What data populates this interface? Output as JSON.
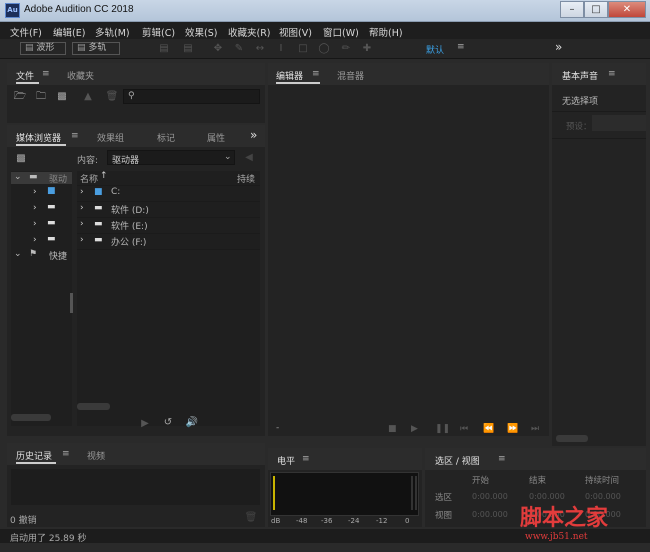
{
  "window": {
    "title": "Adobe Audition CC 2018",
    "app_icon": "Au",
    "minimize": "–",
    "maximize": "□",
    "close": "✕"
  },
  "menu": [
    "文件(F)",
    "编辑(E)",
    "多轨(M)",
    "剪辑(C)",
    "效果(S)",
    "收藏夹(R)",
    "视图(V)",
    "窗口(W)",
    "帮助(H)"
  ],
  "toolbar": {
    "waveform_label": "波形",
    "multitrack_label": "多轨",
    "workspace": "默认",
    "more": "»"
  },
  "files_panel": {
    "tabs": [
      "文件",
      "收藏夹"
    ],
    "search_placeholder": ""
  },
  "media_browser": {
    "tabs": [
      "媒体浏览器",
      "效果组",
      "标记",
      "属性"
    ],
    "more": "»",
    "content_label": "内容:",
    "content_value": "驱动器",
    "tree": [
      "驱动",
      "快捷"
    ],
    "columns": {
      "name": "名称",
      "duration": "持续"
    },
    "rows": [
      "C:",
      "软件 (D:)",
      "软件 (E:)",
      "办公 (F:)"
    ]
  },
  "editor": {
    "tabs": [
      "编辑器",
      "混音器"
    ],
    "time": "-"
  },
  "essential_sound": {
    "tab": "基本声音",
    "message": "无选择项",
    "preset_label": "预设："
  },
  "history": {
    "tabs": [
      "历史记录",
      "视频"
    ],
    "undo_count": "0 撤销"
  },
  "levels": {
    "title": "电平",
    "ticks": [
      "dB",
      "-48",
      "-36",
      "-24",
      "-12",
      "0"
    ]
  },
  "selection_view": {
    "title": "选区 / 视图",
    "columns": [
      "开始",
      "结束",
      "持续时间"
    ],
    "rows": [
      {
        "label": "选区",
        "start": "0:00.000",
        "end": "0:00.000",
        "duration": "0:00.000"
      },
      {
        "label": "视图",
        "start": "0:00.000",
        "end": "0:00.000",
        "duration": "0:00.000"
      }
    ]
  },
  "status": {
    "text": "启动用了 25.89 秒"
  },
  "watermark": {
    "title": "脚本之家",
    "url": "www.jb51.net"
  }
}
